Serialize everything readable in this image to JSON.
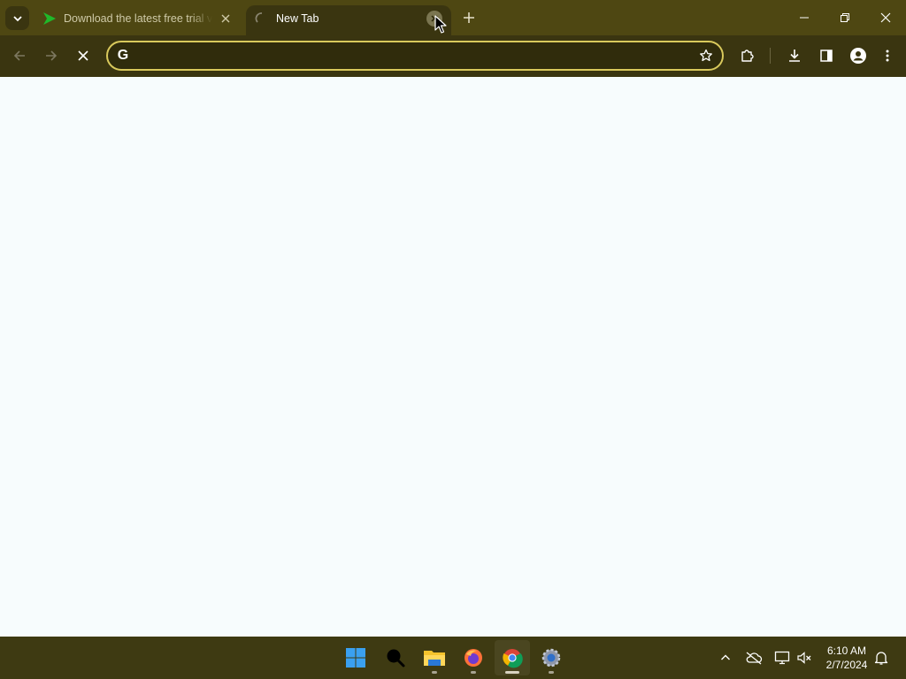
{
  "browser": {
    "tabs": [
      {
        "title": "Download the latest free trial ve",
        "active": false,
        "favicon": "green-play-icon"
      },
      {
        "title": "New Tab",
        "active": true,
        "favicon": "loading-spinner-icon"
      }
    ],
    "omnibox": {
      "value": "",
      "placeholder": ""
    },
    "colors": {
      "frame": "#4e4712",
      "toolbar": "#3a3510",
      "omnibox_border": "#d9c95c",
      "content": "#f7fcfd"
    }
  },
  "taskbar": {
    "apps": [
      {
        "name": "start",
        "icon": "windows-logo-icon"
      },
      {
        "name": "search",
        "icon": "search-icon"
      },
      {
        "name": "file-explorer",
        "icon": "folder-icon"
      },
      {
        "name": "firefox",
        "icon": "firefox-icon"
      },
      {
        "name": "chrome",
        "icon": "chrome-icon",
        "active": true
      },
      {
        "name": "settings",
        "icon": "gear-icon"
      }
    ],
    "clock": {
      "time": "6:10 AM",
      "date": "2/7/2024"
    }
  }
}
